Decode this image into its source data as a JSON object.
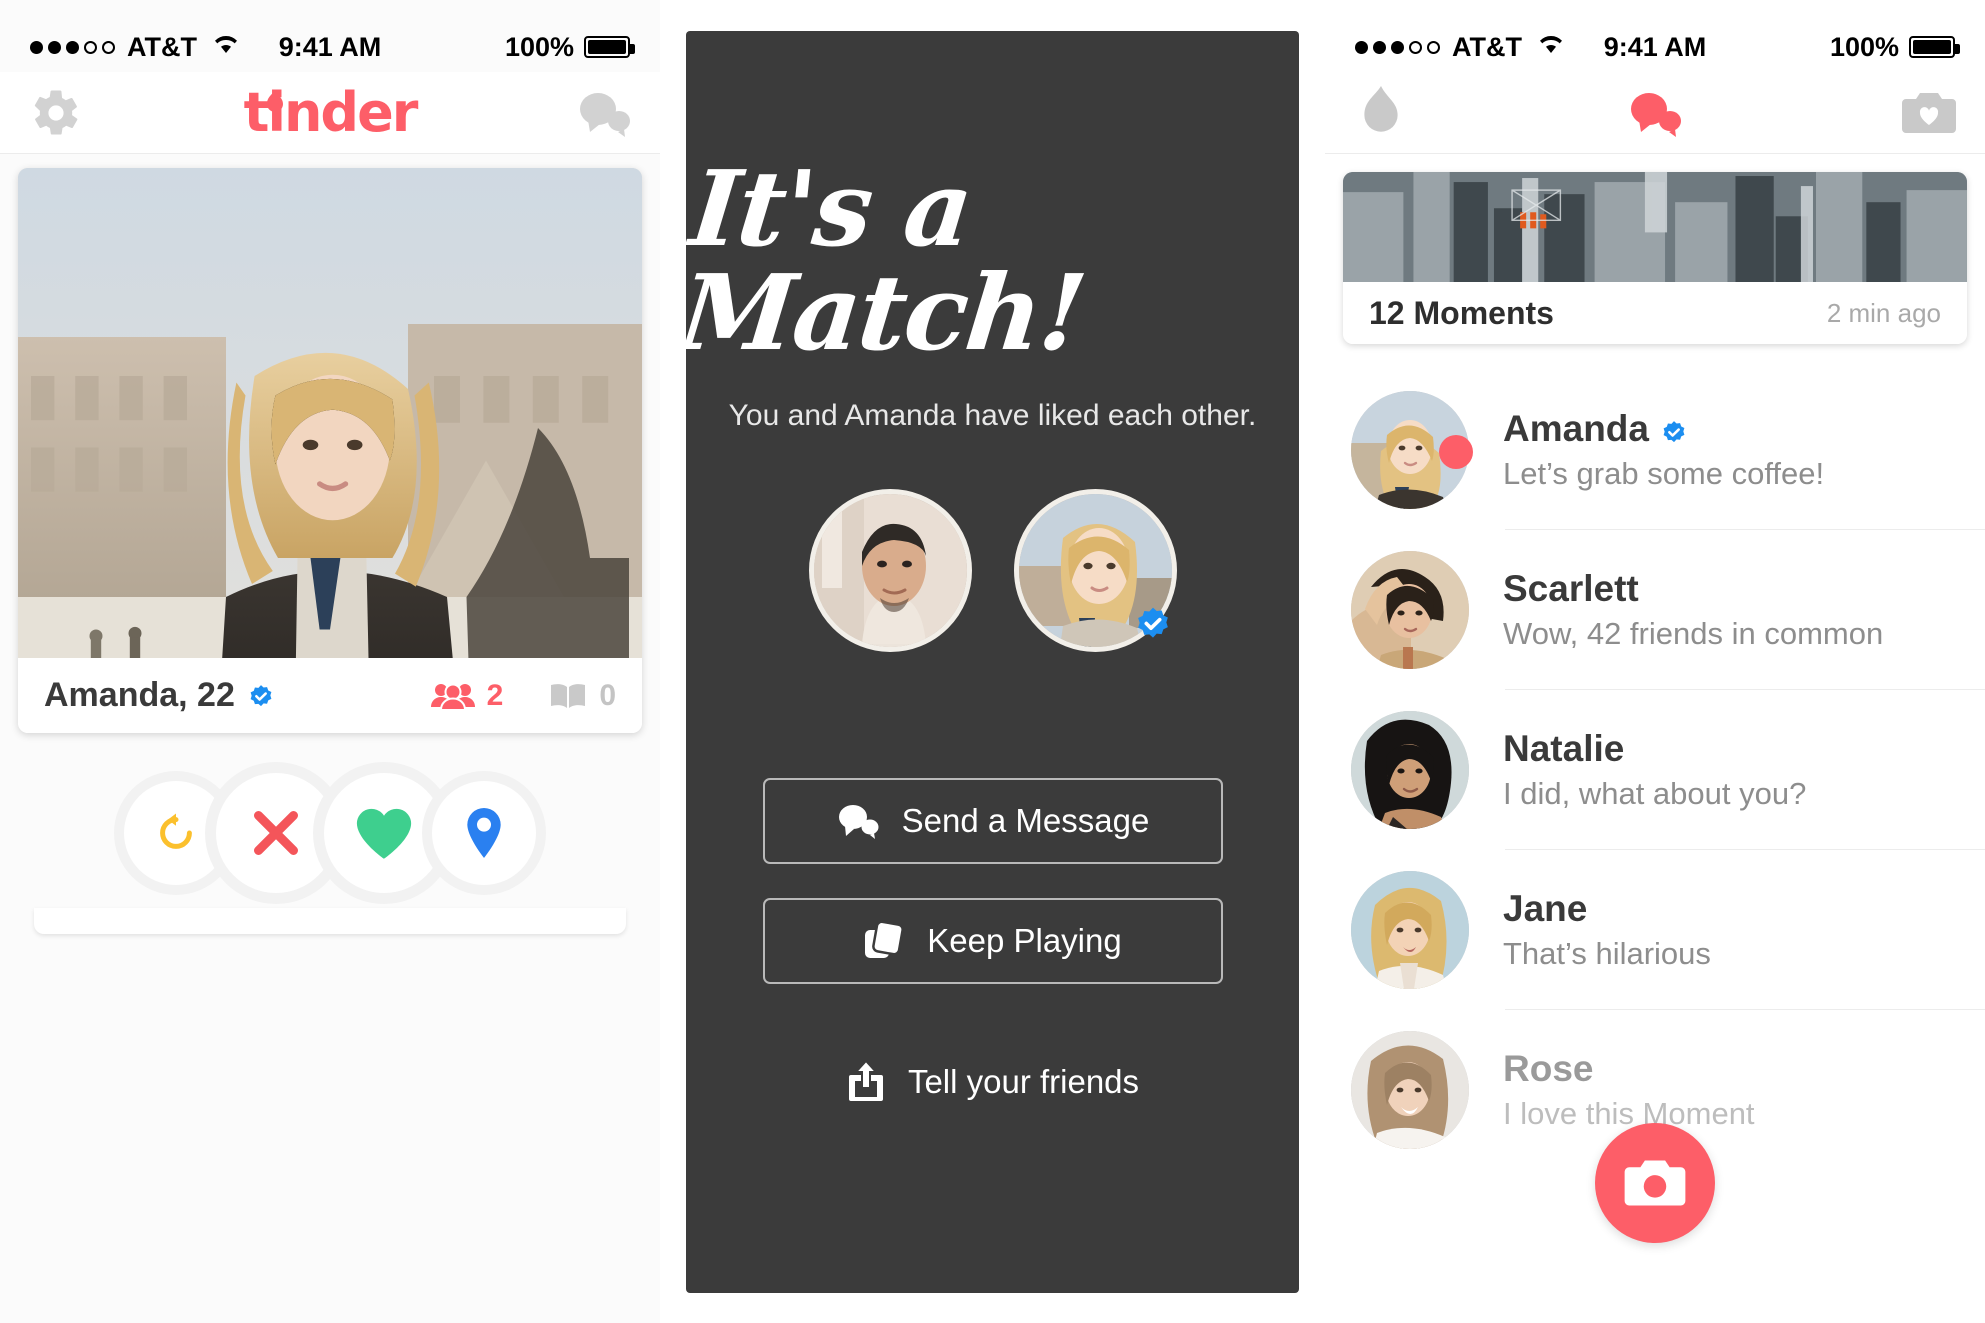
{
  "status_bar": {
    "carrier": "AT&T",
    "time": "9:41 AM",
    "battery": "100%",
    "signal_dots_filled": 3,
    "signal_dots_total": 5
  },
  "colors": {
    "brand_red": "#fd5e68",
    "verified_blue": "#1c8ef0",
    "like_green": "#3ecf8e",
    "nope_red": "#f4555a",
    "rewind_yellow": "#fbc02d",
    "location_blue": "#2a80f0",
    "panel_dark": "#3b3b3b",
    "text_dark": "#3a3a3a",
    "text_muted": "#8d8d8d"
  },
  "left_screen": {
    "nav": {
      "settings_icon": "gear-icon",
      "logo_text": "tinder",
      "messages_icon": "chat-bubbles-icon"
    },
    "card": {
      "name_age": "Amanda, 22",
      "verified": true,
      "friends_icon": "friends-icon",
      "friends_count": "2",
      "interests_icon": "book-icon",
      "interests_count": "0",
      "photo_alt": "woman-in-leather-jacket-at-louvre"
    },
    "actions": [
      {
        "name": "rewind-button",
        "icon": "rewind-icon",
        "color": "#fbc02d"
      },
      {
        "name": "nope-button",
        "icon": "close-x-icon",
        "color": "#f4555a"
      },
      {
        "name": "like-button",
        "icon": "heart-icon",
        "color": "#3ecf8e"
      },
      {
        "name": "location-button",
        "icon": "map-pin-icon",
        "color": "#2a80f0"
      }
    ]
  },
  "match_screen": {
    "title": "It's a Match!",
    "subtitle": "You and Amanda have liked each other.",
    "avatars": [
      {
        "name": "your-avatar",
        "verified": false
      },
      {
        "name": "match-avatar-amanda",
        "verified": true
      }
    ],
    "buttons": [
      {
        "label": "Send a Message",
        "icon": "chat-bubbles-icon",
        "name": "send-a-message-button"
      },
      {
        "label": "Keep Playing",
        "icon": "cards-stack-icon",
        "name": "keep-playing-button"
      }
    ],
    "share": {
      "label": "Tell your friends",
      "icon": "share-upload-icon",
      "name": "tell-your-friends-button"
    }
  },
  "right_screen": {
    "nav": {
      "flame_icon": "flame-icon",
      "messages_icon": "chat-bubbles-icon",
      "moments_icon": "camera-heart-icon",
      "active_tab": "messages"
    },
    "moments": {
      "count_label": "12 Moments",
      "time_label": "2 min ago",
      "photo_alt": "aerial-city-skyline"
    },
    "chats": [
      {
        "name": "Amanda",
        "message": "Let’s grab some coffee!",
        "verified": true,
        "unread": true,
        "faded": false
      },
      {
        "name": "Scarlett",
        "message": "Wow, 42 friends in common",
        "verified": false,
        "unread": false,
        "faded": false
      },
      {
        "name": "Natalie",
        "message": "I did, what about you?",
        "verified": false,
        "unread": false,
        "faded": false
      },
      {
        "name": "Jane",
        "message": "That’s hilarious",
        "verified": false,
        "unread": false,
        "faded": false
      },
      {
        "name": "Rose",
        "message": "I love this Moment",
        "verified": false,
        "unread": false,
        "faded": true
      }
    ],
    "camera_fab": {
      "icon": "camera-icon",
      "name": "new-moment-button"
    }
  }
}
